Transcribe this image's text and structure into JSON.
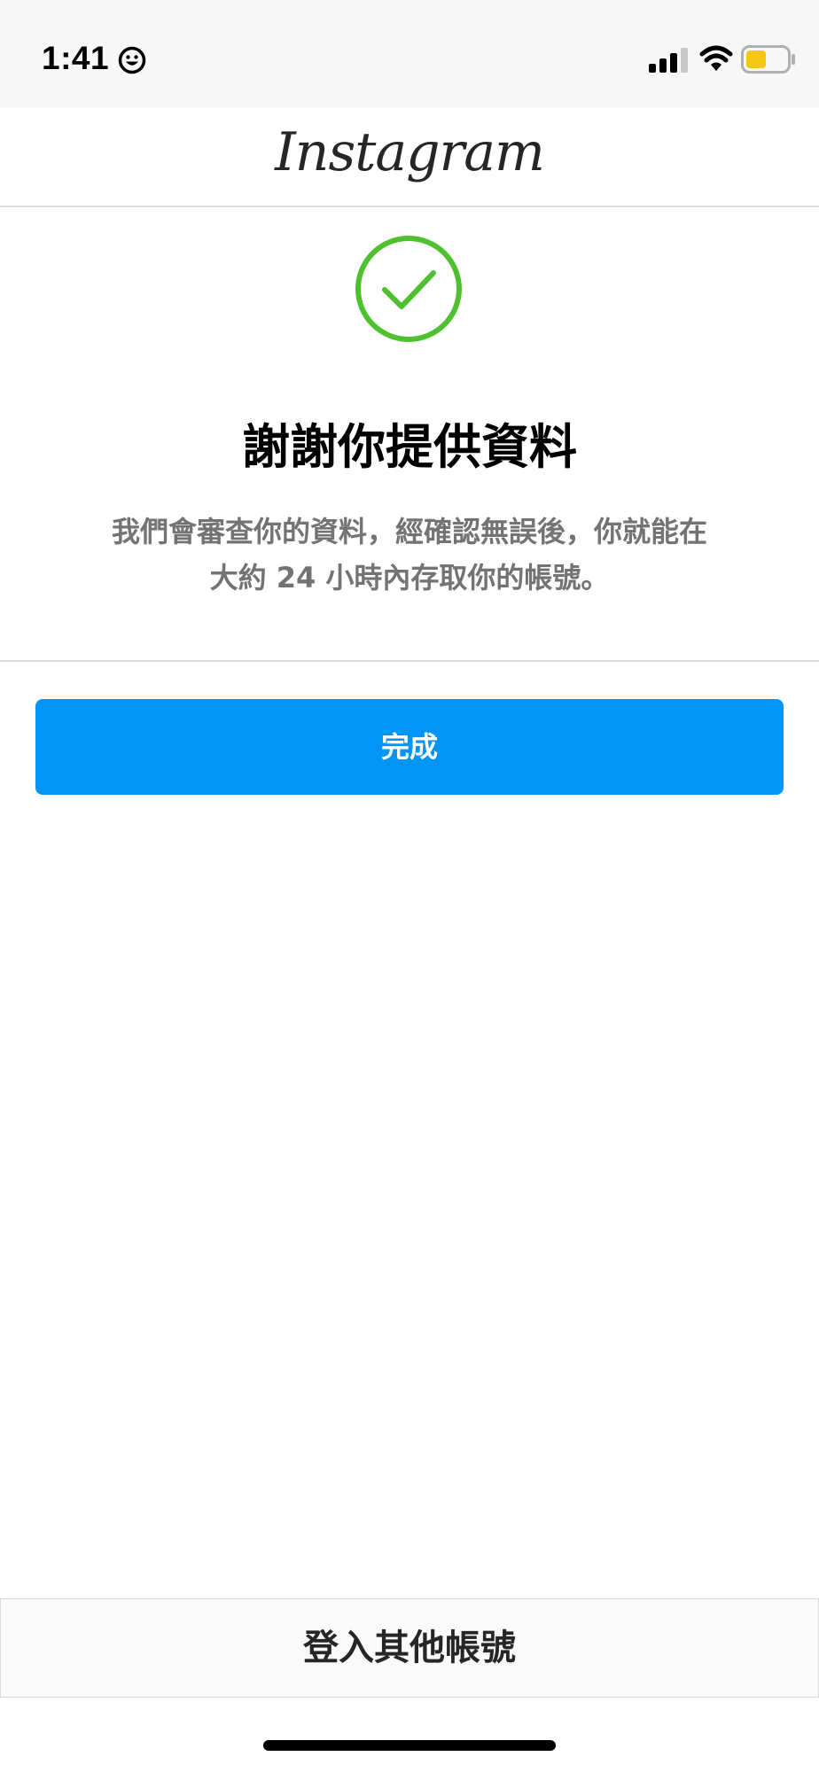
{
  "status_bar": {
    "time": "1:41",
    "icons": [
      "smiley-icon",
      "cellular-signal-icon",
      "wifi-icon",
      "battery-icon"
    ],
    "battery_color": "#f5c518"
  },
  "header": {
    "logo_text": "Instagram"
  },
  "confirmation": {
    "icon": "check-circle-icon",
    "icon_color": "#4fc12e",
    "title": "謝謝你提供資料",
    "description_line1": "我們會審查你的資料，經確認無誤後，你就能在",
    "description_line2": "大約 24 小時內存取你的帳號。"
  },
  "actions": {
    "done_label": "完成",
    "done_color": "#0095f6"
  },
  "footer": {
    "switch_account_label": "登入其他帳號"
  }
}
